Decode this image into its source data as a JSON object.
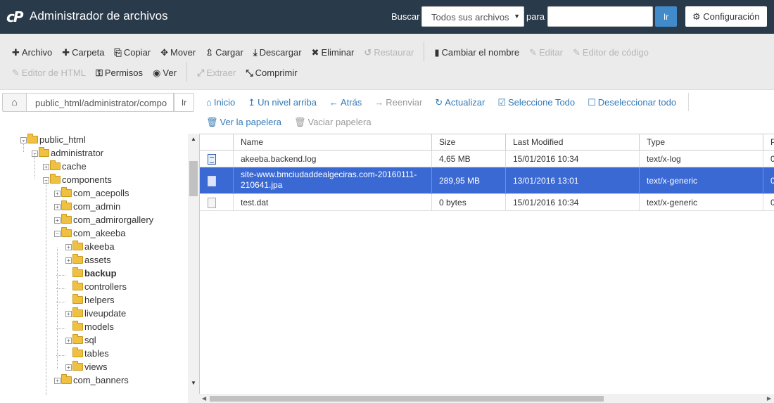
{
  "header": {
    "logo": "cP",
    "title": "Administrador de archivos",
    "search_label": "Buscar",
    "search_scope": "Todos sus archivos",
    "para_label": "para",
    "search_value": "",
    "ir_label": "Ir",
    "config_label": "Configuración"
  },
  "toolbar": {
    "row1": [
      {
        "label": "Archivo",
        "icon": "plus-icon",
        "glyph": "✚",
        "disabled": false
      },
      {
        "label": "Carpeta",
        "icon": "plus-icon",
        "glyph": "✚",
        "disabled": false
      },
      {
        "label": "Copiar",
        "icon": "copy-icon",
        "glyph": "⎘",
        "disabled": false
      },
      {
        "label": "Mover",
        "icon": "move-icon",
        "glyph": "✥",
        "disabled": false
      },
      {
        "label": "Cargar",
        "icon": "upload-icon",
        "glyph": "⇫",
        "disabled": false
      },
      {
        "label": "Descargar",
        "icon": "download-icon",
        "glyph": "⤓",
        "disabled": false
      },
      {
        "label": "Eliminar",
        "icon": "delete-icon",
        "glyph": "✖",
        "disabled": false
      },
      {
        "label": "Restaurar",
        "icon": "restore-icon",
        "glyph": "↺",
        "disabled": true
      },
      {
        "label": "Cambiar el nombre",
        "icon": "rename-icon",
        "glyph": "▮",
        "disabled": false,
        "sep_before": true
      },
      {
        "label": "Editar",
        "icon": "pencil-icon",
        "glyph": "✎",
        "disabled": true
      },
      {
        "label": "Editor de código",
        "icon": "code-editor-icon",
        "glyph": "✎",
        "disabled": true
      }
    ],
    "row2": [
      {
        "label": "Editor de HTML",
        "icon": "html-editor-icon",
        "glyph": "✎",
        "disabled": true
      },
      {
        "label": "Permisos",
        "icon": "key-icon",
        "glyph": "⚿",
        "disabled": false
      },
      {
        "label": "Ver",
        "icon": "eye-icon",
        "glyph": "◉",
        "disabled": false
      },
      {
        "label": "Extraer",
        "icon": "expand-icon",
        "glyph": "⤢",
        "disabled": true,
        "sep_before": true
      },
      {
        "label": "Comprimir",
        "icon": "compress-icon",
        "glyph": "⤡",
        "disabled": false
      }
    ]
  },
  "pathbar": {
    "path": "public_html/administrator/compo",
    "go_label": "Ir"
  },
  "nav": {
    "row1": [
      {
        "label": "Inicio",
        "icon": "home-icon",
        "glyph": "⌂",
        "disabled": false
      },
      {
        "label": "Un nivel arriba",
        "icon": "level-up-icon",
        "glyph": "↥",
        "disabled": false
      },
      {
        "label": "Atrás",
        "icon": "back-arrow-icon",
        "glyph": "←",
        "disabled": false
      },
      {
        "label": "Reenviar",
        "icon": "forward-arrow-icon",
        "glyph": "→",
        "disabled": true
      },
      {
        "label": "Actualizar",
        "icon": "refresh-icon",
        "glyph": "↻",
        "disabled": false
      },
      {
        "label": "Seleccione Todo",
        "icon": "checkbox-checked-icon",
        "glyph": "☑",
        "disabled": false
      },
      {
        "label": "Deseleccionar todo",
        "icon": "checkbox-empty-icon",
        "glyph": "☐",
        "disabled": false
      }
    ],
    "row2": [
      {
        "label": "Ver la papelera",
        "icon": "trash-icon",
        "glyph": "🗑",
        "disabled": false
      },
      {
        "label": "Vaciar papelera",
        "icon": "trash-icon",
        "glyph": "🗑",
        "disabled": true
      }
    ]
  },
  "tree": [
    {
      "label": "public_html",
      "depth": 0,
      "expander": "minus",
      "open": true,
      "selected": false
    },
    {
      "label": "administrator",
      "depth": 1,
      "expander": "minus",
      "open": true,
      "selected": false
    },
    {
      "label": "cache",
      "depth": 2,
      "expander": "plus",
      "open": false,
      "selected": false
    },
    {
      "label": "components",
      "depth": 2,
      "expander": "minus",
      "open": true,
      "selected": false
    },
    {
      "label": "com_acepolls",
      "depth": 3,
      "expander": "plus",
      "open": false,
      "selected": false
    },
    {
      "label": "com_admin",
      "depth": 3,
      "expander": "plus",
      "open": false,
      "selected": false
    },
    {
      "label": "com_admirorgallery",
      "depth": 3,
      "expander": "plus",
      "open": false,
      "selected": false
    },
    {
      "label": "com_akeeba",
      "depth": 3,
      "expander": "minus",
      "open": true,
      "selected": false
    },
    {
      "label": "akeeba",
      "depth": 4,
      "expander": "plus",
      "open": false,
      "selected": false
    },
    {
      "label": "assets",
      "depth": 4,
      "expander": "plus",
      "open": false,
      "selected": false
    },
    {
      "label": "backup",
      "depth": 4,
      "expander": "none",
      "open": false,
      "selected": true
    },
    {
      "label": "controllers",
      "depth": 4,
      "expander": "none",
      "open": false,
      "selected": false
    },
    {
      "label": "helpers",
      "depth": 4,
      "expander": "none",
      "open": false,
      "selected": false
    },
    {
      "label": "liveupdate",
      "depth": 4,
      "expander": "plus",
      "open": false,
      "selected": false
    },
    {
      "label": "models",
      "depth": 4,
      "expander": "none",
      "open": false,
      "selected": false
    },
    {
      "label": "sql",
      "depth": 4,
      "expander": "plus",
      "open": false,
      "selected": false
    },
    {
      "label": "tables",
      "depth": 4,
      "expander": "none",
      "open": false,
      "selected": false
    },
    {
      "label": "views",
      "depth": 4,
      "expander": "plus",
      "open": false,
      "selected": false
    },
    {
      "label": "com_banners",
      "depth": 3,
      "expander": "plus",
      "open": false,
      "selected": false
    }
  ],
  "filelist": {
    "columns": [
      "",
      "Name",
      "Size",
      "Last Modified",
      "Type",
      "P"
    ],
    "rows": [
      {
        "icon": "log-file-icon",
        "kind": "log",
        "name": [
          "akeeba.backend.log"
        ],
        "size": "4,65 MB",
        "modified": "15/01/2016 10:34",
        "type": "text/x-log",
        "perm": "0",
        "selected": false
      },
      {
        "icon": "generic-file-icon",
        "kind": "gen",
        "name": [
          "site-www.bmciudaddealgeciras.com-20160111-",
          "210641.jpa"
        ],
        "size": "289,95 MB",
        "modified": "13/01/2016 13:01",
        "type": "text/x-generic",
        "perm": "0",
        "selected": true
      },
      {
        "icon": "generic-file-icon",
        "kind": "gen",
        "name": [
          "test.dat"
        ],
        "size": "0 bytes",
        "modified": "15/01/2016 10:34",
        "type": "text/x-generic",
        "perm": "0",
        "selected": false
      }
    ]
  }
}
